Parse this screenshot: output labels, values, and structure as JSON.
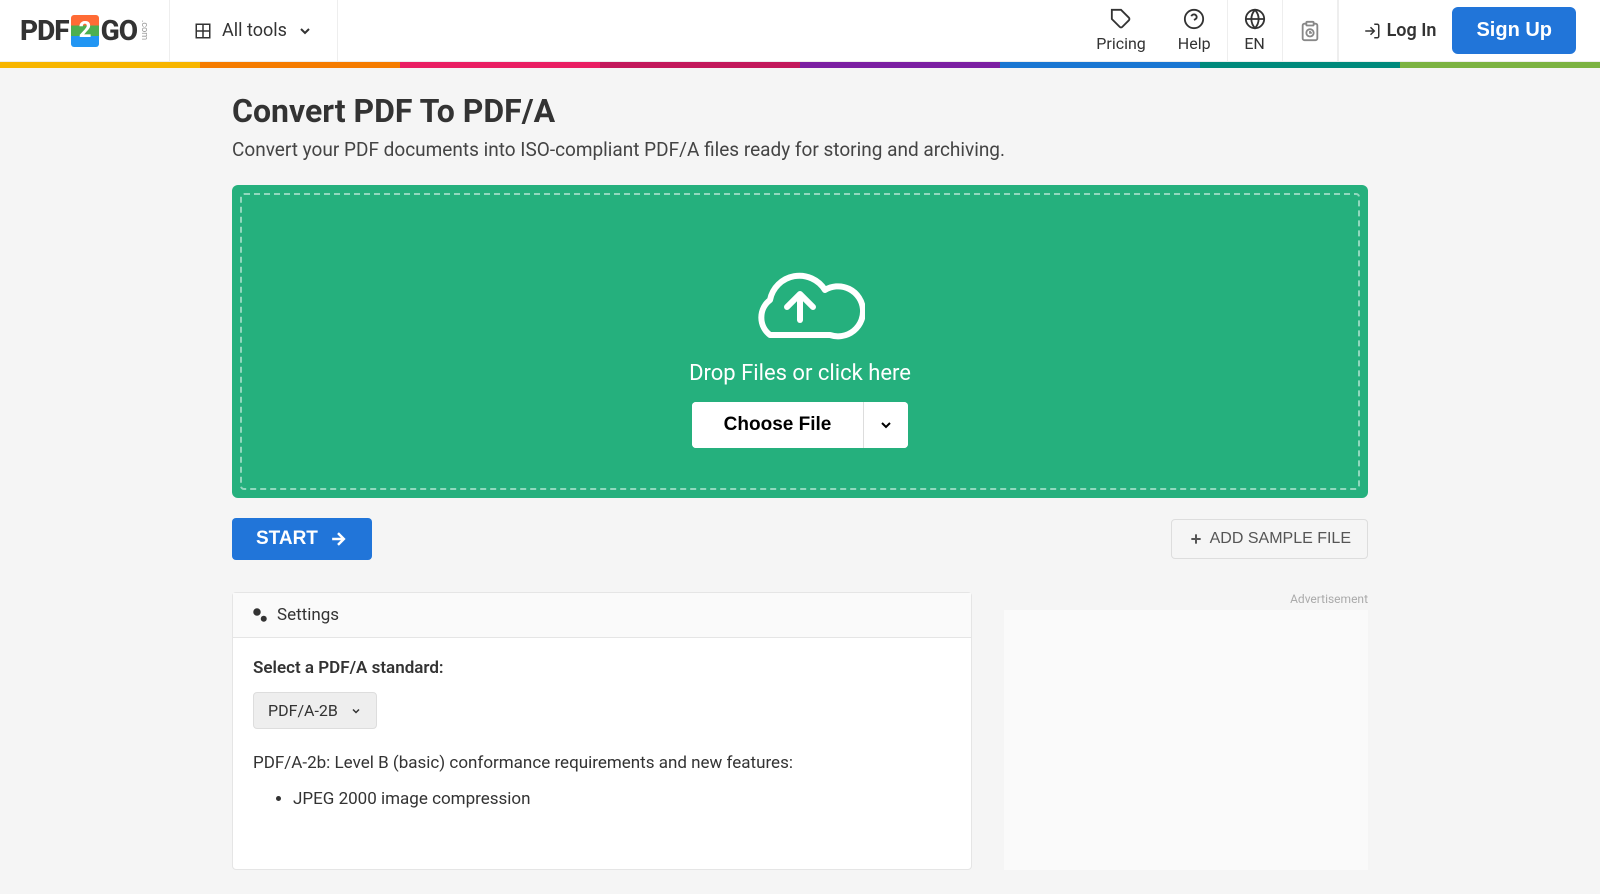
{
  "header": {
    "logo_pdf": "PDF",
    "logo_2": "2",
    "logo_go": "GO",
    "logo_com": ".com",
    "all_tools": "All tools",
    "pricing": "Pricing",
    "help": "Help",
    "language": "EN",
    "login": "Log In",
    "signup": "Sign Up"
  },
  "page": {
    "title": "Convert PDF To PDF/A",
    "subtitle": "Convert your PDF documents into ISO-compliant PDF/A files ready for storing and archiving."
  },
  "dropzone": {
    "text": "Drop Files or click here",
    "choose_file": "Choose File"
  },
  "actions": {
    "start": "START",
    "add_sample": "ADD SAMPLE FILE"
  },
  "settings": {
    "heading": "Settings",
    "select_label": "Select a PDF/A standard:",
    "selected_standard": "PDF/A-2B",
    "description": "PDF/A-2b: Level B (basic) conformance requirements and new features:",
    "features": [
      "JPEG 2000 image compression"
    ]
  },
  "ad": {
    "label": "Advertisement"
  }
}
